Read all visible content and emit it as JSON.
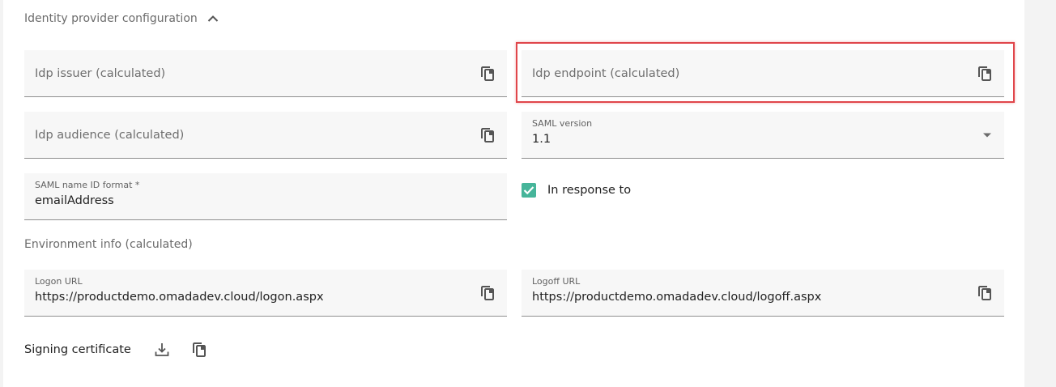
{
  "section": {
    "title": "Identity provider configuration",
    "collapse_icon": "chevron-up-icon"
  },
  "fields": {
    "idp_issuer": {
      "placeholder": "Idp issuer (calculated)",
      "icon": "copy-icon"
    },
    "idp_endpoint": {
      "placeholder": "Idp endpoint (calculated)",
      "icon": "copy-icon"
    },
    "idp_audience": {
      "placeholder": "Idp audience (calculated)",
      "icon": "copy-icon"
    },
    "saml_version": {
      "label": "SAML version",
      "value": "1.1",
      "icon": "dropdown-arrow-icon"
    },
    "saml_name_id_format": {
      "label": "SAML name ID format *",
      "value": "emailAddress"
    },
    "in_response_to": {
      "label": "In response to",
      "checked": true
    }
  },
  "environment": {
    "title": "Environment info (calculated)",
    "logon_url": {
      "label": "Logon URL",
      "value": "https://productdemo.omadadev.cloud/logon.aspx",
      "icon": "copy-icon"
    },
    "logoff_url": {
      "label": "Logoff URL",
      "value": "https://productdemo.omadadev.cloud/logoff.aspx",
      "icon": "copy-icon"
    }
  },
  "signing": {
    "label": "Signing certificate",
    "icons": [
      "download-icon",
      "copy-icon"
    ]
  },
  "colors": {
    "checkbox": "#46b59a",
    "highlight": "#e0464b",
    "field_bg": "#f7f7f7"
  }
}
